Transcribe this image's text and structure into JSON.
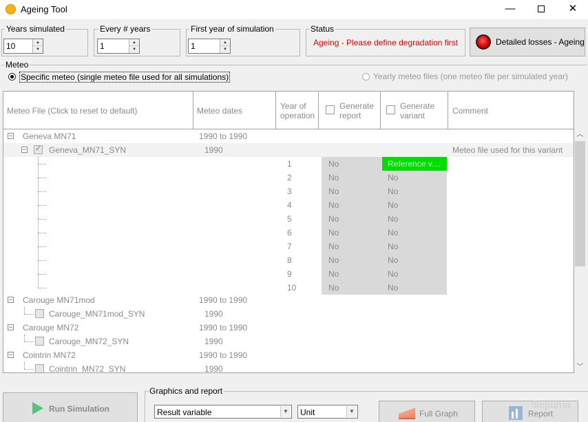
{
  "window": {
    "title": "Ageing Tool",
    "minimize": "—",
    "close": "✕"
  },
  "params": {
    "years_simulated": {
      "label": "Years simulated",
      "value": "10"
    },
    "every_years": {
      "label": "Every # years",
      "value": "1"
    },
    "first_year": {
      "label": "First year of simulation",
      "value": "1"
    }
  },
  "status": {
    "label": "Status",
    "text": "Ageing - Please define degradation first",
    "color": "#e00000"
  },
  "detailed_button": {
    "label": "Detailed losses - Ageing"
  },
  "meteo": {
    "group_label": "Meteo",
    "option_specific": "Specific meteo (single meteo file used for all simulations)",
    "option_yearly": "Yearly meteo files (one meteo file per simulated year)",
    "selected": "specific"
  },
  "table": {
    "headers": {
      "meteo_file": "Meteo File (Click to reset to default)",
      "meteo_dates": "Meteo dates",
      "year_of_operation_1": "Year of",
      "year_of_operation_2": "operation",
      "generate_report_1": "Generate",
      "generate_report_2": "report",
      "generate_variant_1": "Generate",
      "generate_variant_2": "variant",
      "comment": "Comment"
    },
    "groups": [
      {
        "name": "Geneva MN71",
        "dates": "1990 to 1990",
        "file": "Geneva_MN71_SYN",
        "file_dates": "1990",
        "checked": true,
        "comment": "Meteo file used for this variant"
      },
      {
        "name": "Carouge MN71mod",
        "dates": "1990 to 1990",
        "file": "Carouge_MN71mod_SYN",
        "file_dates": "1990"
      },
      {
        "name": "Carouge MN72",
        "dates": "1990 to 1990",
        "file": "Carouge_MN72_SYN",
        "file_dates": "1990"
      },
      {
        "name": "Cointrin MN72",
        "dates": "1990 to 1990",
        "file": "Cointrin_MN72_SYN",
        "file_dates": "1990"
      }
    ],
    "years": [
      {
        "year": "1",
        "report": "No",
        "variant": "Reference v...."
      },
      {
        "year": "2",
        "report": "No",
        "variant": "No"
      },
      {
        "year": "3",
        "report": "No",
        "variant": "No"
      },
      {
        "year": "4",
        "report": "No",
        "variant": "No"
      },
      {
        "year": "5",
        "report": "No",
        "variant": "No"
      },
      {
        "year": "6",
        "report": "No",
        "variant": "No"
      },
      {
        "year": "7",
        "report": "No",
        "variant": "No"
      },
      {
        "year": "8",
        "report": "No",
        "variant": "No"
      },
      {
        "year": "9",
        "report": "No",
        "variant": "No"
      },
      {
        "year": "10",
        "report": "No",
        "variant": "No"
      }
    ]
  },
  "bottom": {
    "run_button": "Run Simulation",
    "graphics_label": "Graphics and report",
    "result_variable": "Result variable",
    "unit": "Unit",
    "full_graph": "Full Graph",
    "report": "Report"
  },
  "watermark": "filepuma",
  "colors": {
    "reference_green": "#00dd00",
    "status_red": "#e00000"
  }
}
